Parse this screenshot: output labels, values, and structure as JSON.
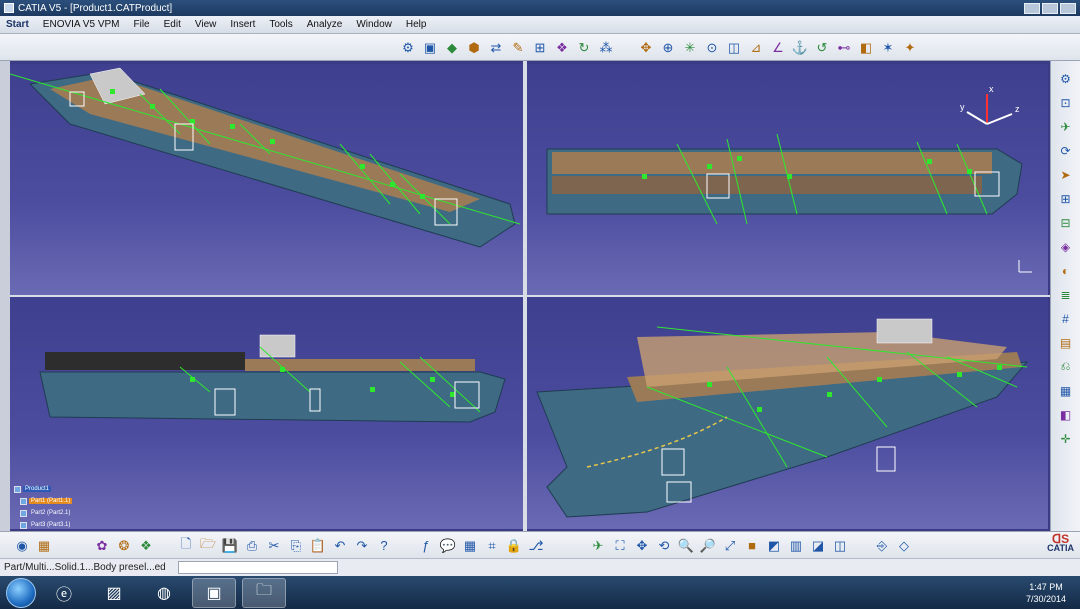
{
  "window": {
    "title": "CATIA V5 - [Product1.CATProduct]"
  },
  "menu": [
    "Start",
    "ENOVIA V5 VPM",
    "File",
    "Edit",
    "View",
    "Insert",
    "Tools",
    "Analyze",
    "Window",
    "Help"
  ],
  "spec_tree": {
    "root": "Product1",
    "children": [
      {
        "label": "Part1 (Part1.1)",
        "selected": true
      },
      {
        "label": "Part2 (Part2.1)",
        "selected": false
      },
      {
        "label": "Part3 (Part3.1)",
        "selected": false
      }
    ]
  },
  "viewports": [
    {
      "name": "isometric"
    },
    {
      "name": "top"
    },
    {
      "name": "side"
    },
    {
      "name": "perspective"
    }
  ],
  "compass_labels": {
    "x": "x",
    "y": "y",
    "z": "z"
  },
  "colors": {
    "viewport_bg": "#4848a0",
    "hull": "#3e6a84",
    "hull_dark": "#1f3c52",
    "deck": "#9b7a58",
    "annotation": "#2ee82e",
    "selection": "#e58a1e"
  },
  "status": {
    "text": "Part/Multi...Solid.1...Body presel...ed"
  },
  "logo": {
    "text": "CATIA"
  },
  "clock": {
    "time": "1:47 PM",
    "date": "7/30/2014"
  }
}
